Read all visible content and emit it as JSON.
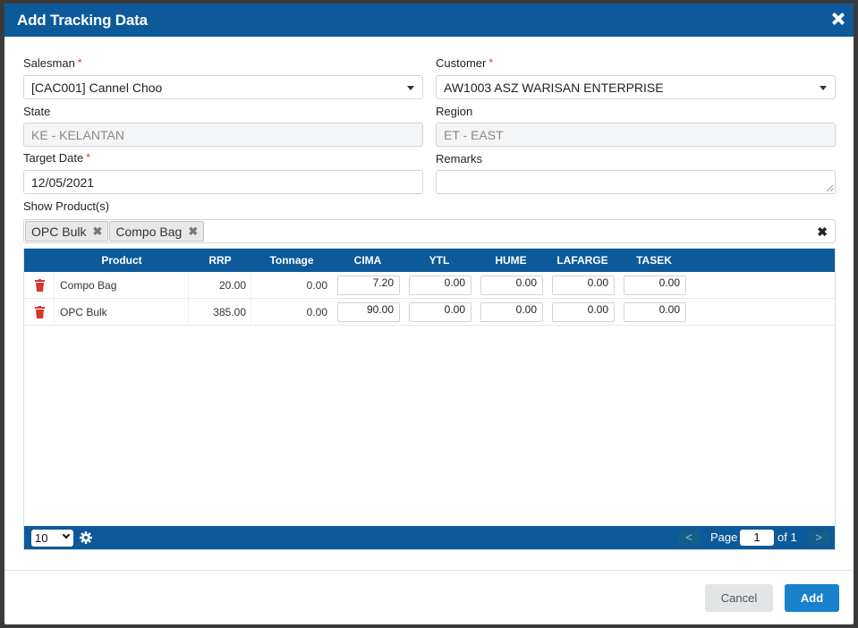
{
  "modal": {
    "title": "Add Tracking Data",
    "close_icon": "close-icon"
  },
  "form": {
    "salesman_label": "Salesman",
    "salesman_value": "[CAC001] Cannel Choo",
    "customer_label": "Customer",
    "customer_value": "AW1003 ASZ WARISAN ENTERPRISE",
    "state_label": "State",
    "state_value": "KE - KELANTAN",
    "region_label": "Region",
    "region_value": "ET - EAST",
    "target_date_label": "Target Date",
    "target_date_value": "12/05/2021",
    "remarks_label": "Remarks",
    "remarks_value": "",
    "show_products_label": "Show Product(s)",
    "required_mark": "*",
    "selected_products": [
      "OPC Bulk",
      "Compo Bag"
    ],
    "tag_remove": "✖",
    "clear_all": "✖"
  },
  "grid": {
    "columns": [
      "Product",
      "RRP",
      "Tonnage",
      "CIMA",
      "YTL",
      "HUME",
      "LAFARGE",
      "TASEK"
    ],
    "rows": [
      {
        "product": "Compo Bag",
        "rrp": "20.00",
        "tonnage": "0.00",
        "cima": "7.20",
        "ytl": "0.00",
        "hume": "0.00",
        "lafarge": "0.00",
        "tasek": "0.00"
      },
      {
        "product": "OPC Bulk",
        "rrp": "385.00",
        "tonnage": "0.00",
        "cima": "90.00",
        "ytl": "0.00",
        "hume": "0.00",
        "lafarge": "0.00",
        "tasek": "0.00"
      }
    ],
    "row_delete_icon": "trash-icon",
    "accent_color": "#0c5a9a"
  },
  "pager": {
    "page_size": "10",
    "settings_icon": "gear-icon",
    "prev": "<",
    "next": ">",
    "page_label": "Page",
    "page_value": "1",
    "of_label": "of 1"
  },
  "footer": {
    "cancel_label": "Cancel",
    "add_label": "Add",
    "add_color": "#1a82cc"
  }
}
